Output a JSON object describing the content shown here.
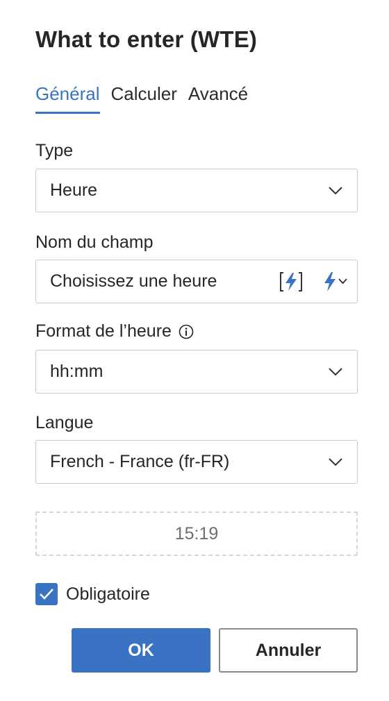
{
  "dialog": {
    "title": "What to enter (WTE)"
  },
  "tabs": [
    {
      "label": "Général",
      "active": true
    },
    {
      "label": "Calculer",
      "active": false
    },
    {
      "label": "Avancé",
      "active": false
    }
  ],
  "type_field": {
    "label": "Type",
    "value": "Heure"
  },
  "name_field": {
    "label": "Nom du champ",
    "placeholder": "Choisissez une heure"
  },
  "format_field": {
    "label": "Format de l’heure",
    "value": "hh:mm"
  },
  "language_field": {
    "label": "Langue",
    "value": "French - France (fr-FR)"
  },
  "preview": {
    "value": "15:19"
  },
  "required": {
    "label": "Obligatoire",
    "checked": true
  },
  "buttons": {
    "ok": "OK",
    "cancel": "Annuler"
  },
  "colors": {
    "accent": "#3a73c4",
    "text": "#262626",
    "border": "#c8c8c8"
  }
}
